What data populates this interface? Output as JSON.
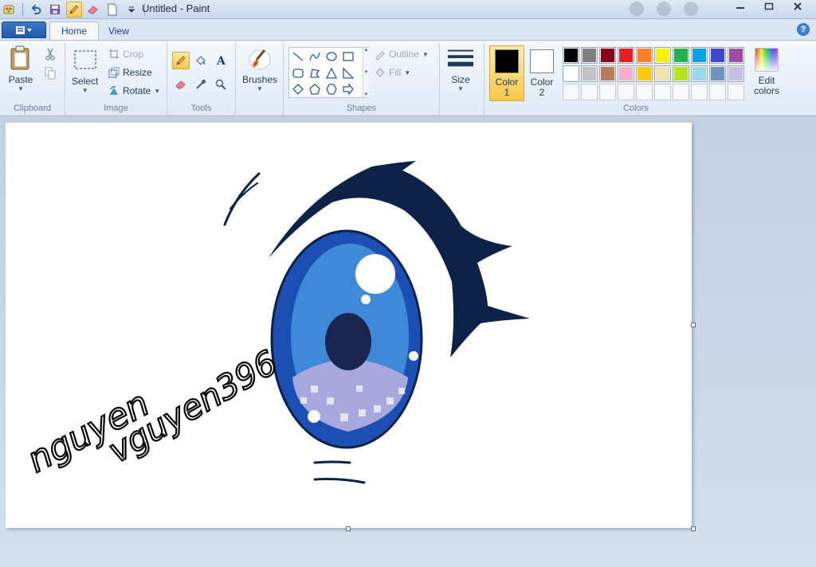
{
  "window": {
    "title": "Untitled - Paint",
    "controls": [
      "minimize-icon",
      "maximize-icon",
      "close-icon"
    ]
  },
  "quick_access": [
    "paint-app-icon",
    "undo-icon",
    "save-icon",
    "pencil-icon",
    "eraser-icon",
    "new-file-icon",
    "customize-dropdown-icon"
  ],
  "tabs": {
    "file": "",
    "items": [
      {
        "label": "Home",
        "selected": true
      },
      {
        "label": "View",
        "selected": false
      }
    ],
    "help": "?"
  },
  "ribbon": {
    "clipboard": {
      "label": "Clipboard",
      "paste": "Paste"
    },
    "image": {
      "label": "Image",
      "select": "Select",
      "crop": "Crop",
      "resize": "Resize",
      "rotate": "Rotate"
    },
    "tools": {
      "label": "Tools",
      "active_tool": "pencil"
    },
    "brushes": {
      "label": "Brushes"
    },
    "shapes": {
      "label": "Shapes",
      "outline": "Outline",
      "fill": "Fill"
    },
    "size": {
      "label": "Size"
    },
    "colors": {
      "label": "Colors",
      "color1": {
        "label": "Color",
        "num": "1",
        "value": "#000000"
      },
      "color2": {
        "label": "Color",
        "num": "2",
        "value": "#ffffff"
      },
      "edit": "Edit colors",
      "palette": [
        "#000000",
        "#7f7f7f",
        "#880015",
        "#ed1c24",
        "#ff7f27",
        "#fff200",
        "#22b14c",
        "#00a2e8",
        "#3f48cc",
        "#a349a4",
        "#ffffff",
        "#c3c3c3",
        "#b97a57",
        "#ffaec9",
        "#ffc90e",
        "#efe4b0",
        "#b5e61d",
        "#99d9ea",
        "#7092be",
        "#c8bfe7"
      ],
      "empty_slots": 10
    }
  },
  "canvas": {
    "signature_line1": "nguyen",
    "signature_line2": "vguyen396",
    "colors": {
      "lash": "#0c2249",
      "iris_outer": "#1c4fb3",
      "iris_mid": "#3f8ad8",
      "iris_light": "#a8a8de",
      "pupil": "#1b2650"
    }
  }
}
